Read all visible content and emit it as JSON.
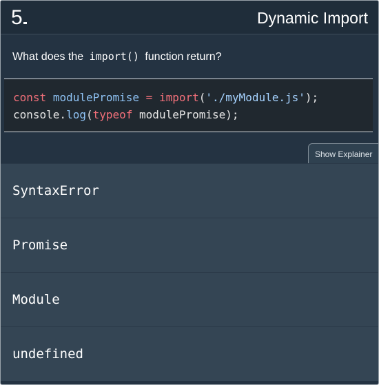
{
  "header": {
    "number": "5",
    "title": "Dynamic Import"
  },
  "question": {
    "prefix": "What does the ",
    "code": "import()",
    "suffix": " function return?"
  },
  "code_lines": [
    [
      {
        "t": "const",
        "c": "kw"
      },
      {
        "t": " ",
        "c": "pln"
      },
      {
        "t": "modulePromise",
        "c": "var"
      },
      {
        "t": " = ",
        "c": "kw"
      },
      {
        "t": "import",
        "c": "kw"
      },
      {
        "t": "(",
        "c": "pln"
      },
      {
        "t": "'./myModule.js'",
        "c": "str"
      },
      {
        "t": ");",
        "c": "pln"
      }
    ],
    [
      {
        "t": "console.",
        "c": "pln"
      },
      {
        "t": "log",
        "c": "var"
      },
      {
        "t": "(",
        "c": "pln"
      },
      {
        "t": "typeof",
        "c": "kw"
      },
      {
        "t": " modulePromise);",
        "c": "pln"
      }
    ]
  ],
  "explainer_button": "Show Explainer",
  "options": [
    "SyntaxError",
    "Promise",
    "Module",
    "undefined"
  ],
  "colors": {
    "background": "#243342",
    "option_bg": "#344554",
    "keyword": "#f3707a",
    "identifier": "#8fc3f5"
  }
}
